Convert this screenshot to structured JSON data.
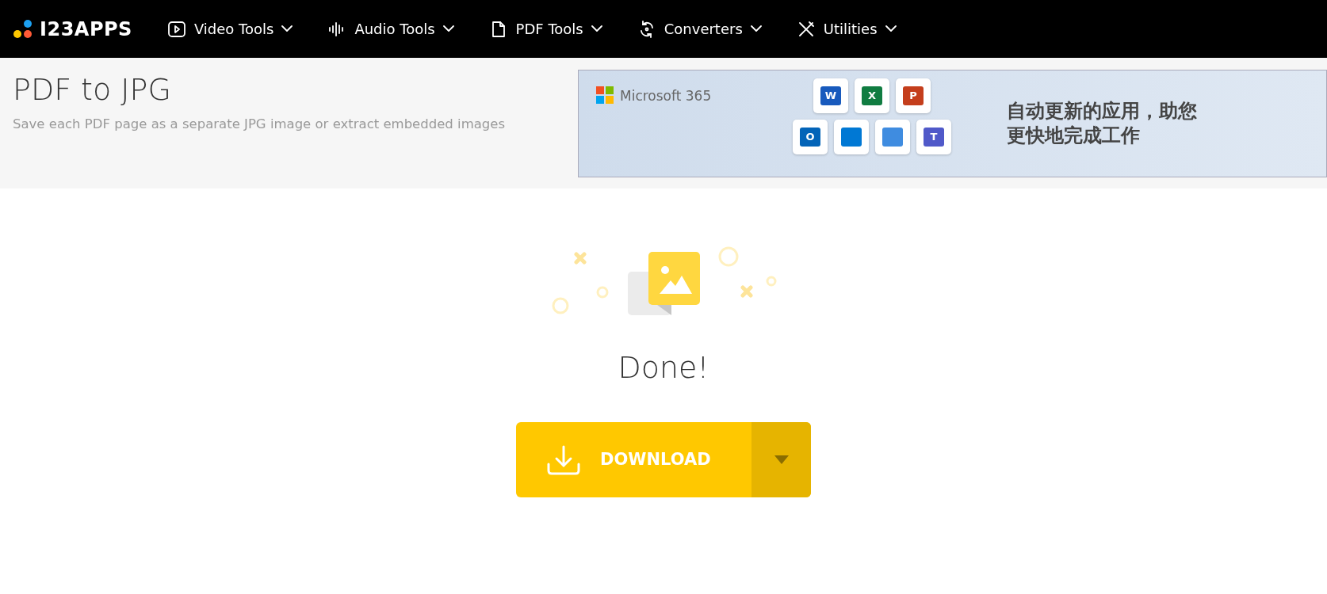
{
  "logo": {
    "text": "I23APPS"
  },
  "nav": [
    {
      "label": "Video Tools",
      "kind": "video"
    },
    {
      "label": "Audio Tools",
      "kind": "audio"
    },
    {
      "label": "PDF Tools",
      "kind": "pdf"
    },
    {
      "label": "Converters",
      "kind": "convert"
    },
    {
      "label": "Utilities",
      "kind": "utilities"
    }
  ],
  "header": {
    "title": "PDF to JPG",
    "subtitle": "Save each PDF page as a separate JPG image or extract embedded images"
  },
  "ad": {
    "brand": "Microsoft 365",
    "lines": [
      "自动更新的应用，助您",
      "更快地完成工作"
    ],
    "apps": [
      {
        "letter": "W",
        "color": "#185abd"
      },
      {
        "letter": "X",
        "color": "#107c41"
      },
      {
        "letter": "P",
        "color": "#c43e1c"
      },
      {
        "letter": "O",
        "color": "#0364b8"
      },
      {
        "color": "#0078d4"
      },
      {
        "color": "#3f8ce0"
      },
      {
        "letter": "T",
        "color": "#5059c9"
      }
    ]
  },
  "result": {
    "status": "Done!",
    "download": "DOWNLOAD"
  }
}
